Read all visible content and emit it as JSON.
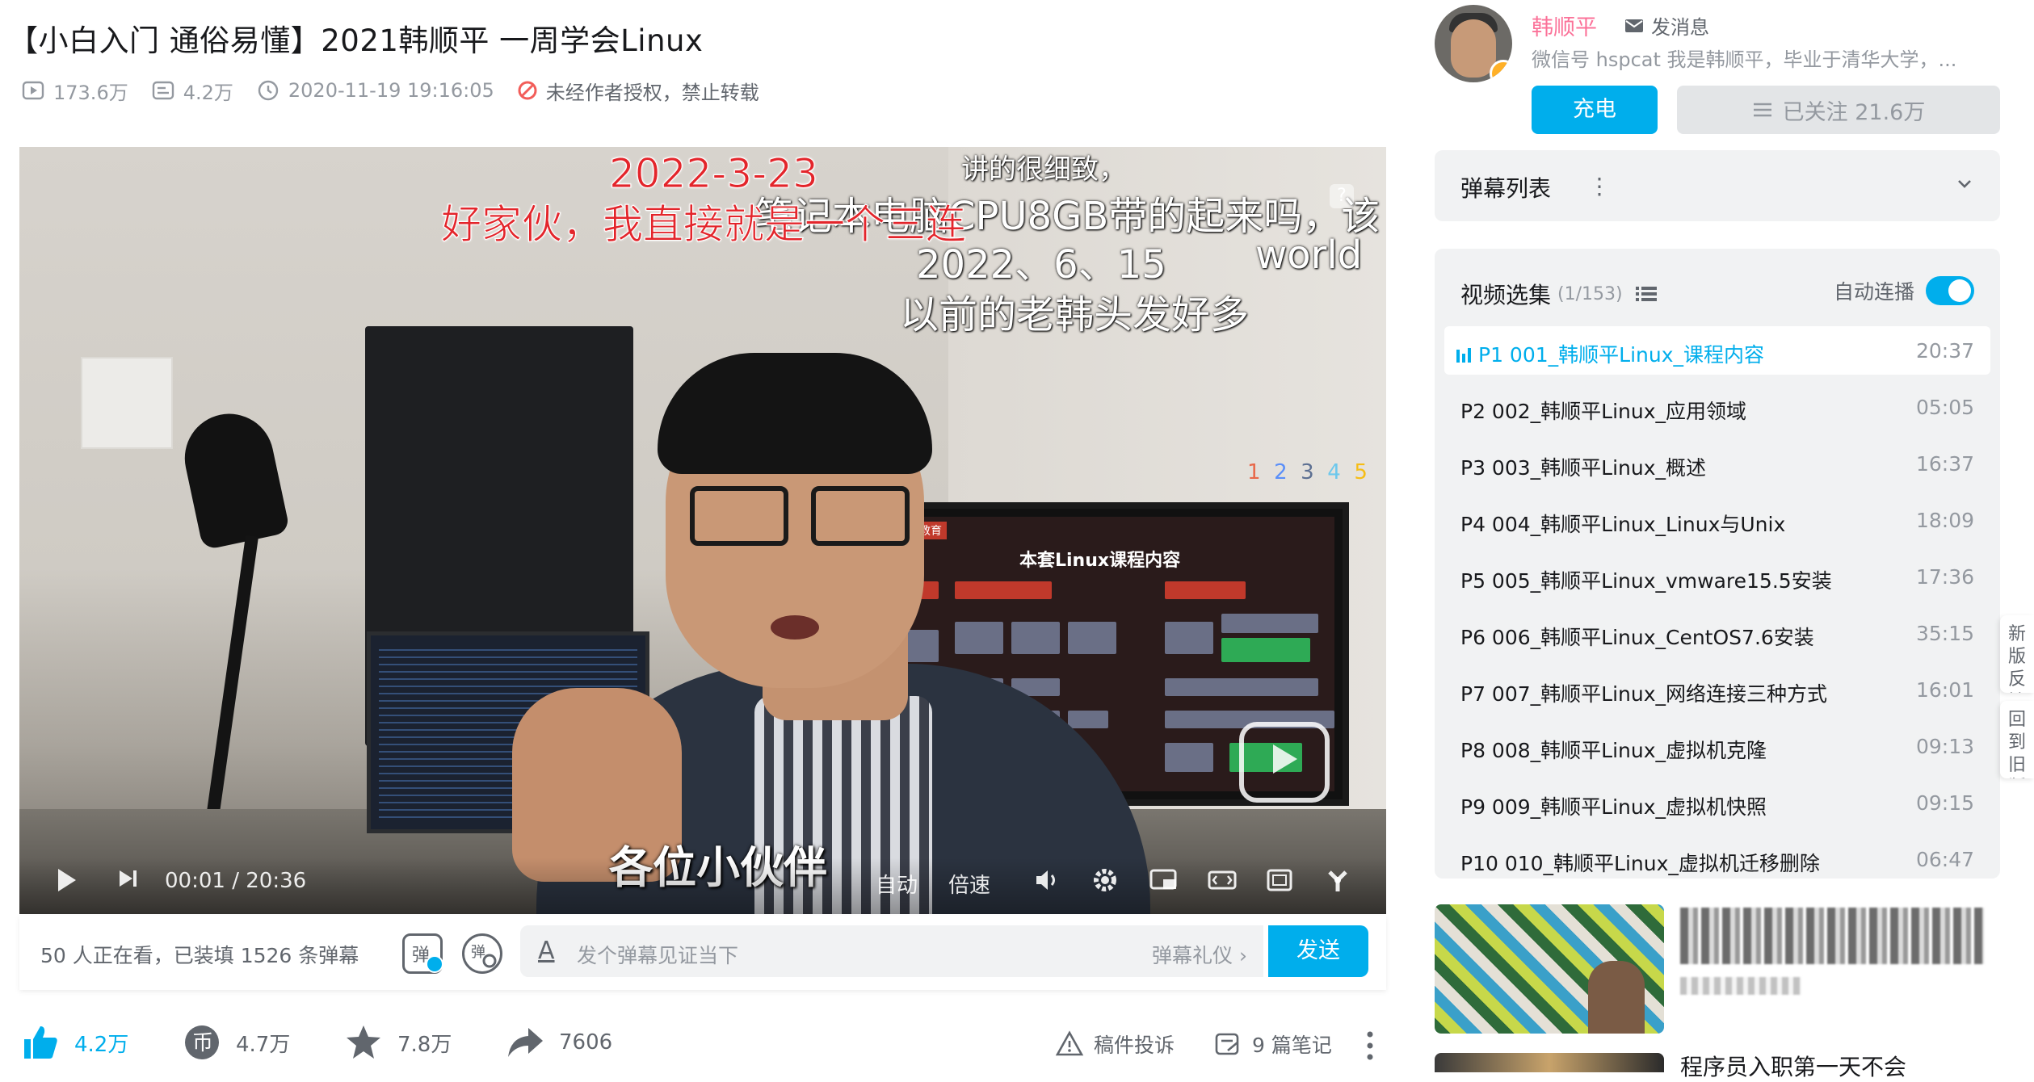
{
  "video": {
    "title": "【小白入门 通俗易懂】2021韩顺平 一周学会Linux",
    "views": "173.6万",
    "danmaku_count": "4.2万",
    "published": "2020-11-19 19:16:05",
    "copyright": "未经作者授权，禁止转载"
  },
  "player": {
    "danmaku": [
      "2022-3-23",
      "好家伙，我直接就是一个三连",
      "讲的很细致，",
      "笔记本电脑CPU8GB带的起来吗，该",
      "2022、6、15",
      "world",
      "以前的老韩头发好多"
    ],
    "subtitle": "各位小伙伴",
    "time_current": "00:01",
    "time_separator": "/",
    "time_total": "20:36",
    "auto_label": "自动",
    "speed_label": "倍速",
    "badge_question": "?",
    "badge_numbers": [
      "1",
      "2",
      "3",
      "4",
      "5"
    ],
    "slide_title": "本套Linux课程内容",
    "slide_brand": "韩顺平教育"
  },
  "sendbar": {
    "watching": "50 人正在看，已装填 1526 条弹幕",
    "toggle_label": "弹",
    "input_placeholder": "发个弹幕见证当下",
    "etiquette": "弹幕礼仪",
    "send": "发送"
  },
  "actions": {
    "like": "4.2万",
    "coin": "4.7万",
    "favorite": "7.8万",
    "share": "7606",
    "report": "稿件投诉",
    "notes": "9 篇笔记"
  },
  "uploader": {
    "name": "韩顺平",
    "message": "发消息",
    "description": "微信号 hspcat 我是韩顺平，毕业于清华大学，...",
    "charge": "充电",
    "followed": "已关注 21.6万"
  },
  "danmu_list": {
    "title": "弹幕列表"
  },
  "playlist": {
    "title": "视频选集",
    "count": "(1/153)",
    "autoplay": "自动连播",
    "episodes": [
      {
        "label": "P1  001_韩顺平Linux_课程内容",
        "duration": "20:37"
      },
      {
        "label": "P2  002_韩顺平Linux_应用领域",
        "duration": "05:05"
      },
      {
        "label": "P3  003_韩顺平Linux_概述",
        "duration": "16:37"
      },
      {
        "label": "P4  004_韩顺平Linux_Linux与Unix",
        "duration": "18:09"
      },
      {
        "label": "P5  005_韩顺平Linux_vmware15.5安装",
        "duration": "17:36"
      },
      {
        "label": "P6  006_韩顺平Linux_CentOS7.6安装",
        "duration": "35:15"
      },
      {
        "label": "P7  007_韩顺平Linux_网络连接三种方式",
        "duration": "16:01"
      },
      {
        "label": "P8  008_韩顺平Linux_虚拟机克隆",
        "duration": "09:13"
      },
      {
        "label": "P9  009_韩顺平Linux_虚拟机快照",
        "duration": "09:15"
      },
      {
        "label": "P10  010_韩顺平Linux_虚拟机迁移删除",
        "duration": "06:47"
      }
    ]
  },
  "side_tabs": {
    "feedback": "新版反馈",
    "old": "回到旧版"
  },
  "recommend": {
    "second_title": "程序员入职第一天不会"
  },
  "colors": {
    "accent": "#00aeec",
    "up_name": "#fb7299",
    "danmaku_red": "#e3252b"
  }
}
